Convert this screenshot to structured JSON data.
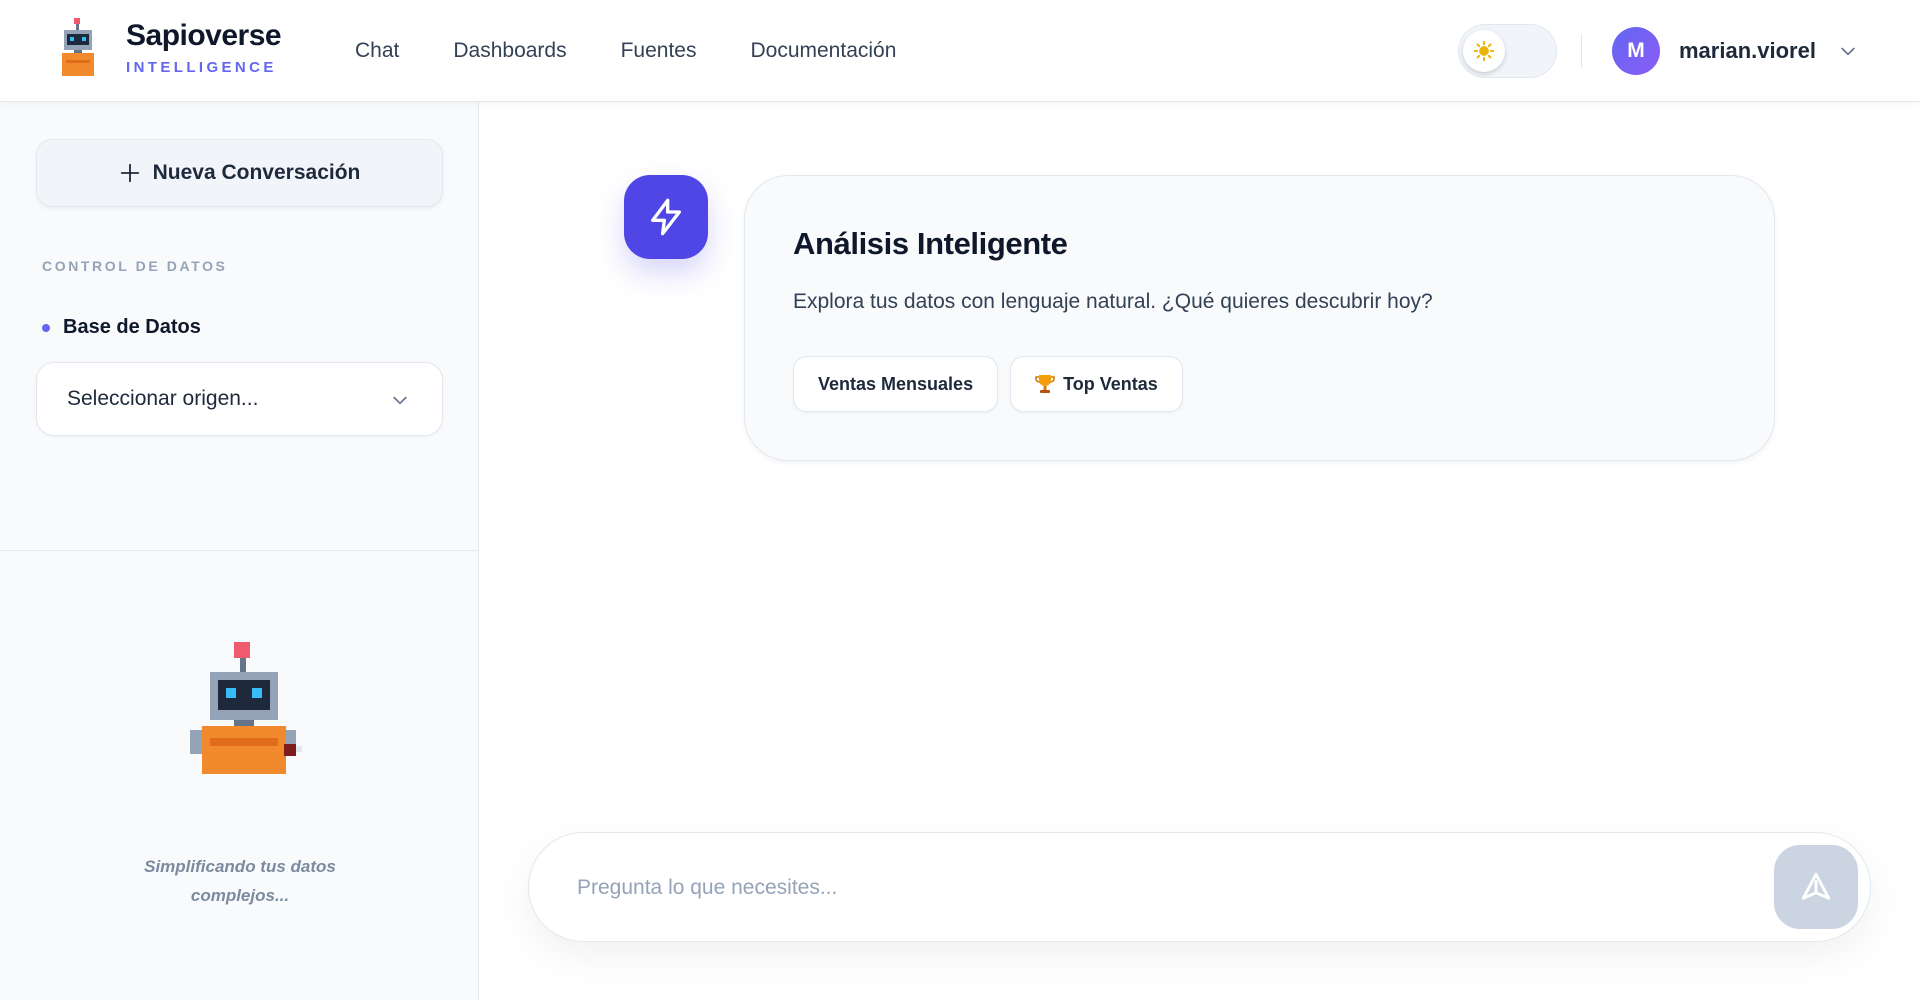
{
  "brand": {
    "name": "Sapioverse",
    "subtitle": "INTELLIGENCE",
    "logo_icon": "robot-logo-icon"
  },
  "nav": {
    "items": [
      {
        "label": "Chat"
      },
      {
        "label": "Dashboards"
      },
      {
        "label": "Fuentes"
      },
      {
        "label": "Documentación"
      }
    ]
  },
  "header": {
    "theme_toggle": {
      "icon": "sun-icon",
      "state": "light"
    },
    "user": {
      "initial": "M",
      "name": "marian.viorel",
      "menu_icon": "chevron-down-icon"
    }
  },
  "sidebar": {
    "new_chat_label": "Nueva Conversación",
    "section_title": "CONTROL DE DATOS",
    "db_label": "Base de Datos",
    "source_select": {
      "value": "Seleccionar origen...",
      "icon": "chevron-down-icon"
    },
    "tagline": "Simplificando tus datos complejos..."
  },
  "main": {
    "card": {
      "icon": "lightning-bolt-icon",
      "title": "Análisis Inteligente",
      "description": "Explora tus datos con lenguaje natural. ¿Qué quieres descubrir hoy?",
      "suggestions": [
        {
          "label": "Ventas Mensuales"
        },
        {
          "label": "Top Ventas",
          "icon": "trophy-icon"
        }
      ]
    },
    "composer": {
      "placeholder": "Pregunta lo que necesites...",
      "value": "",
      "send_icon": "send-icon"
    }
  },
  "colors": {
    "accent": "#4f46e5",
    "accent_light": "#6366f1",
    "avatar": "#7c5cf4",
    "send_disabled": "#cbd5e1"
  }
}
